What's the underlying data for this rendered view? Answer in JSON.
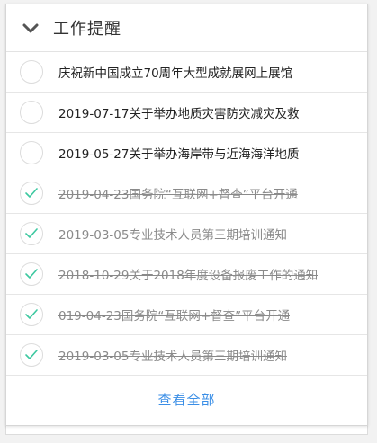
{
  "panel": {
    "title": "工作提醒",
    "collapse_icon": "chevron-down-icon"
  },
  "tasks": [
    {
      "label": "庆祝新中国成立70周年大型成就展网上展馆",
      "done": false
    },
    {
      "label": "2019-07-17关于举办地质灾害防灾减灾及救",
      "done": false
    },
    {
      "label": "2019-05-27关于举办海岸带与近海海洋地质",
      "done": false
    },
    {
      "label": "2019-04-23国务院“互联网+督查”平台开通",
      "done": true
    },
    {
      "label": "2019-03-05专业技术人员第三期培训通知",
      "done": true
    },
    {
      "label": "2018-10-29关于2018年度设备报废工作的通知",
      "done": true
    },
    {
      "label": "019-04-23国务院“互联网+督查”平台开通",
      "done": true
    },
    {
      "label": "2019-03-05专业技术人员第三期培训通知",
      "done": true
    }
  ],
  "footer": {
    "view_all_label": "查看全部"
  },
  "colors": {
    "check": "#3cc8a0",
    "link": "#3a8ee6"
  }
}
